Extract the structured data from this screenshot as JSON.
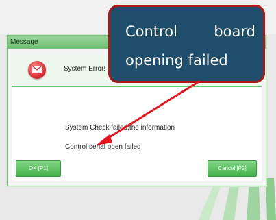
{
  "dialog": {
    "title": "Message",
    "header_text": "System Error!",
    "message_line1": "System Check failed,the information",
    "message_line2": "Control serial open failed",
    "ok_button": "OK [P1]",
    "cancel_button": "Cancel [P2]"
  },
  "callout": {
    "line1_word1": "Control",
    "line1_word2": "board",
    "line2": "opening failed"
  },
  "colors": {
    "accent_green": "#6dbf71",
    "callout_fill": "#1e4e6b",
    "callout_border": "#b01718",
    "arrow": "#e8141c"
  },
  "icons": {
    "error": "envelope-error-icon"
  }
}
